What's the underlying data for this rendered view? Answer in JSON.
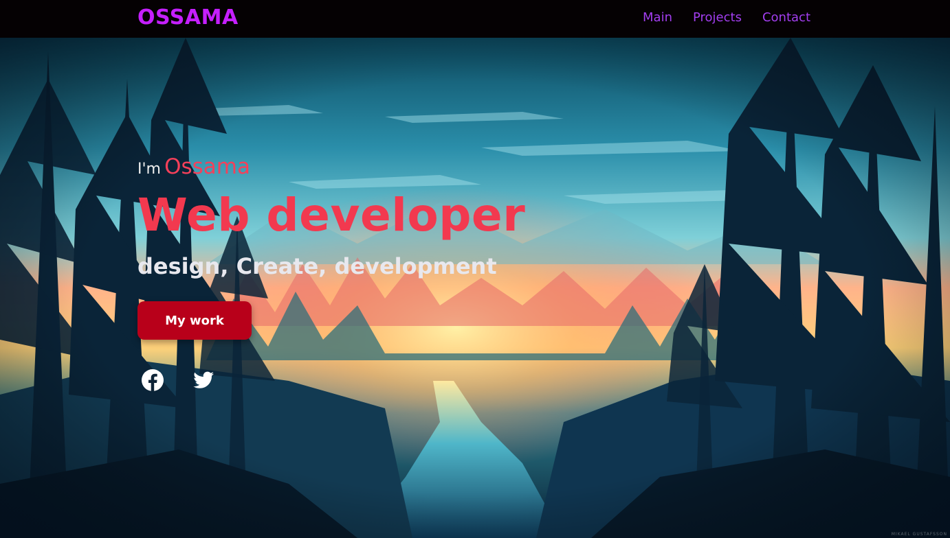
{
  "brand": {
    "logo": "OSSAMA"
  },
  "nav": {
    "items": [
      {
        "label": "Main"
      },
      {
        "label": "Projects"
      },
      {
        "label": "Contact"
      }
    ]
  },
  "hero": {
    "intro_prefix": "I'm",
    "intro_name": "Ossama",
    "headline": "Web developer",
    "tagline": "design, Create, development",
    "cta_label": "My work",
    "socials": [
      {
        "icon": "facebook-icon"
      },
      {
        "icon": "twitter-icon"
      }
    ],
    "artist_credit": "MIKAEL GUSTAFSSON"
  },
  "colors": {
    "brand": "#c51fff",
    "nav_link": "#a33ef0",
    "accent": "#f2394f",
    "button": "#b8001a",
    "navbar_bg": "#050103"
  }
}
